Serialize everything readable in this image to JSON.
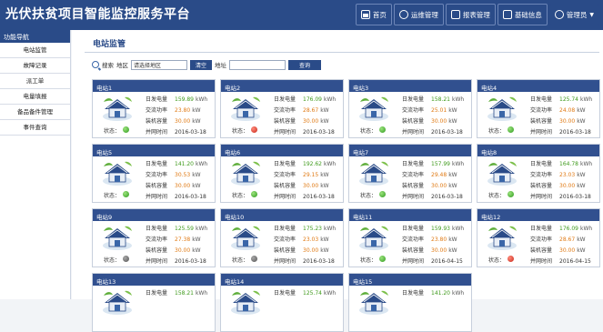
{
  "app_title": "光伏扶贫项目智能监控服务平台",
  "nav": {
    "items": [
      {
        "label": "首页",
        "icon": "home-icon"
      },
      {
        "label": "运维管理",
        "icon": "gear-icon"
      },
      {
        "label": "报表管理",
        "icon": "report-icon"
      },
      {
        "label": "基础信息",
        "icon": "id-card-icon"
      }
    ],
    "user_label": "管理员"
  },
  "sidebar": {
    "title": "功能导航",
    "items": [
      "电站监管",
      "故障记录",
      "派工单",
      "电量填报",
      "备品备件管理",
      "事件查询"
    ]
  },
  "page_title": "电站监管",
  "search": {
    "label": "搜索",
    "region_label": "地区",
    "region_value": "请选择地区",
    "clear_button": "清空",
    "address_label": "地址",
    "address_value": "",
    "query_button": "查询"
  },
  "card_labels": {
    "daily_energy": "日发电量",
    "ac_power": "交流功率",
    "capacity": "装机容量",
    "grid_time": "并网时间",
    "status": "状态：",
    "unit_kwh": "kWh",
    "unit_kw": "kW"
  },
  "stations": [
    {
      "name": "电站1",
      "daily": "159.89",
      "power": "23.80",
      "capacity": "30.00",
      "date": "2016-03-18",
      "status": "green"
    },
    {
      "name": "电站2",
      "daily": "176.09",
      "power": "28.67",
      "capacity": "30.00",
      "date": "2016-03-18",
      "status": "red"
    },
    {
      "name": "电站3",
      "daily": "158.21",
      "power": "25.01",
      "capacity": "30.00",
      "date": "2016-03-18",
      "status": "green"
    },
    {
      "name": "电站4",
      "daily": "125.74",
      "power": "24.08",
      "capacity": "30.00",
      "date": "2016-03-18",
      "status": "green"
    },
    {
      "name": "电站5",
      "daily": "141.20",
      "power": "30.53",
      "capacity": "30.00",
      "date": "2016-03-18",
      "status": "green"
    },
    {
      "name": "电站6",
      "daily": "192.62",
      "power": "29.15",
      "capacity": "30.00",
      "date": "2016-03-18",
      "status": "green"
    },
    {
      "name": "电站7",
      "daily": "157.99",
      "power": "29.48",
      "capacity": "30.00",
      "date": "2016-03-18",
      "status": "green"
    },
    {
      "name": "电站8",
      "daily": "164.78",
      "power": "23.03",
      "capacity": "30.00",
      "date": "2016-03-18",
      "status": "green"
    },
    {
      "name": "电站9",
      "daily": "125.59",
      "power": "27.38",
      "capacity": "30.00",
      "date": "2016-03-18",
      "status": "gray"
    },
    {
      "name": "电站10",
      "daily": "175.23",
      "power": "23.03",
      "capacity": "30.00",
      "date": "2016-03-18",
      "status": "gray"
    },
    {
      "name": "电站11",
      "daily": "159.93",
      "power": "23.80",
      "capacity": "30.00",
      "date": "2016-04-15",
      "status": "green"
    },
    {
      "name": "电站12",
      "daily": "176.09",
      "power": "28.67",
      "capacity": "30.00",
      "date": "2016-04-15",
      "status": "red"
    },
    {
      "name": "电站13",
      "daily": "158.21",
      "power": "",
      "capacity": "",
      "date": "",
      "status": ""
    },
    {
      "name": "电站14",
      "daily": "125.74",
      "power": "",
      "capacity": "",
      "date": "",
      "status": ""
    },
    {
      "name": "电站15",
      "daily": "141.20",
      "power": "",
      "capacity": "",
      "date": "",
      "status": ""
    }
  ],
  "colors": {
    "header": "#2a4b88",
    "card_header": "#31508f",
    "value_green": "#3e9a1b",
    "value_orange": "#e07a14"
  }
}
